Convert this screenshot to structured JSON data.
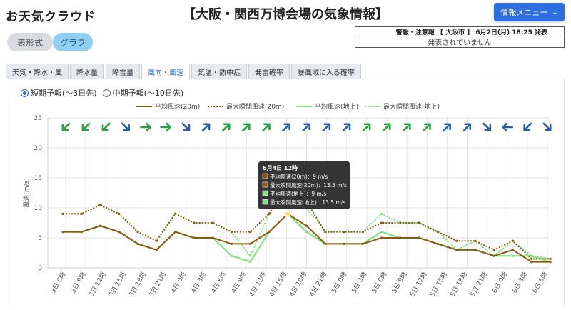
{
  "header": {
    "logo_text": "お天気クラウド",
    "title": "【大阪・関西万博会場の気象情報】",
    "menu_label": "情報メニュー",
    "menu_caret": "⌄"
  },
  "warning": {
    "heading": "警報・注意報 【 大阪市 】 6月2日(月) 18:25 発表",
    "message": "発表されていません"
  },
  "view_toggle": {
    "table_label": "表形式",
    "graph_label": "グラフ",
    "selected": "graph"
  },
  "tabs": [
    {
      "label": "天気・降水・風"
    },
    {
      "label": "降水量"
    },
    {
      "label": "降雪量"
    },
    {
      "label": "風向・風速",
      "active": true
    },
    {
      "label": "気温・熱中症"
    },
    {
      "label": "発雷確率"
    },
    {
      "label": "暴風域に入る確率"
    }
  ],
  "forecast_range": {
    "short_label": "短期予報(～3日先)",
    "mid_label": "中期予報(～10日先)",
    "selected": "short"
  },
  "chart_data": {
    "type": "line",
    "ylabel": "風速(m/s)",
    "ylim": [
      0,
      25
    ],
    "yticks": [
      0,
      5,
      10,
      15,
      20,
      25
    ],
    "grid": true,
    "legend": "top",
    "x": [
      "3日 6時",
      "3日 9時",
      "3日 12時",
      "3日 15時",
      "3日 18時",
      "3日 21時",
      "4日 0時",
      "4日 3時",
      "4日 6時",
      "4日 9時",
      "4日 12時",
      "4日 15時",
      "4日 18時",
      "4日 21時",
      "5日 0時",
      "5日 3時",
      "5日 6時",
      "5日 9時",
      "5日 12時",
      "5日 15時",
      "5日 18時",
      "5日 21時",
      "6日 0時",
      "6日 3時",
      "6日 6時"
    ],
    "x_tick_labels": [
      "3日 6時",
      "3日 9時",
      "3日 12時",
      "3日 15時",
      "3日 18時",
      "3日 21時",
      "4日 0時",
      "4日 3時",
      "4日 6時",
      "4日 9時",
      "4日 12時",
      "4日 15時",
      "4日 18時",
      "4日 21時",
      "5日 0時",
      "5日 3時",
      "5日 6時",
      "5日 9時",
      "5日 12時",
      "5日 15時",
      "5日 18時",
      "5日 21時",
      "6日 0時",
      "6日 3時",
      "6日 6時"
    ],
    "series": [
      {
        "name": "平均風速(20m)",
        "color": "#8a5a10",
        "dashed": false,
        "values": [
          6,
          6,
          7,
          6,
          4,
          3,
          6,
          5,
          5,
          4,
          4,
          6,
          9,
          7,
          4,
          4,
          4,
          5,
          5,
          5,
          4,
          3,
          3,
          2,
          3,
          1,
          1
        ]
      },
      {
        "name": "最大瞬間風速(20m)",
        "color": "#8a5a10",
        "dashed": true,
        "values": [
          9,
          9,
          10.5,
          9,
          6,
          4.5,
          9,
          7.5,
          7.5,
          6,
          6,
          9,
          13.5,
          11,
          6,
          6,
          6,
          7.5,
          7.5,
          7.5,
          6,
          4.5,
          4.5,
          3,
          4.5,
          1.5,
          1.5
        ]
      },
      {
        "name": "平均風速(地上)",
        "color": "#7ee57e",
        "dashed": false,
        "values": [
          6,
          6,
          7,
          6,
          4,
          3,
          6,
          5,
          5,
          2,
          1,
          6,
          9,
          6,
          4,
          4,
          4,
          6,
          5,
          5,
          4,
          3,
          3,
          2,
          2,
          2,
          1
        ]
      },
      {
        "name": "最大瞬間風速(地上)",
        "color": "#7ee57e",
        "dashed": true,
        "values": [
          9,
          9,
          10.5,
          9,
          6,
          4.5,
          9,
          7.5,
          7.5,
          6,
          2,
          9,
          13.5,
          10,
          6,
          6,
          6,
          9,
          7.5,
          7.5,
          6,
          3,
          4.5,
          2,
          4.5,
          2,
          1.5
        ]
      }
    ],
    "wind_direction_arrows": [
      {
        "dir": "southwest",
        "color": "#27a341"
      },
      {
        "dir": "southwest",
        "color": "#27a341"
      },
      {
        "dir": "southwest",
        "color": "#27a341"
      },
      {
        "dir": "southeast",
        "color": "#2860a8"
      },
      {
        "dir": "east",
        "color": "#27a341"
      },
      {
        "dir": "east",
        "color": "#27a341"
      },
      {
        "dir": "southeast",
        "color": "#2860a8"
      },
      {
        "dir": "northeast",
        "color": "#2860a8"
      },
      {
        "dir": "northeast",
        "color": "#27a341"
      },
      {
        "dir": "northeast",
        "color": "#27a341"
      },
      {
        "dir": "northeast",
        "color": "#27a341"
      },
      {
        "dir": "northeast",
        "color": "#2860a8"
      },
      {
        "dir": "northeast",
        "color": "#2860a8"
      },
      {
        "dir": "northeast",
        "color": "#2860a8"
      },
      {
        "dir": "northeast",
        "color": "#2860a8"
      },
      {
        "dir": "northeast",
        "color": "#27a341"
      },
      {
        "dir": "northeast",
        "color": "#27a341"
      },
      {
        "dir": "northeast",
        "color": "#27a341"
      },
      {
        "dir": "northeast",
        "color": "#27a341"
      },
      {
        "dir": "northeast",
        "color": "#2860a8"
      },
      {
        "dir": "northeast",
        "color": "#2860a8"
      },
      {
        "dir": "southeast",
        "color": "#2860a8"
      },
      {
        "dir": "west",
        "color": "#2860a8"
      },
      {
        "dir": "southwest",
        "color": "#2860a8"
      },
      {
        "dir": "southeast",
        "color": "#2860a8"
      }
    ],
    "tooltip": {
      "title": "6月4日 12時",
      "rows": [
        {
          "text": "平均風速(20m)：9 m/s",
          "color": "#8a5a10"
        },
        {
          "text": "最大瞬間風速(20m)：13.5 m/s",
          "color": "#8a5a10"
        },
        {
          "text": "平均風速(地上)：9 m/s",
          "color": "#7ee57e"
        },
        {
          "text": "最大瞬間風速(地上)：13.5 m/s",
          "color": "#7ee57e"
        }
      ],
      "x_index": 12
    }
  }
}
